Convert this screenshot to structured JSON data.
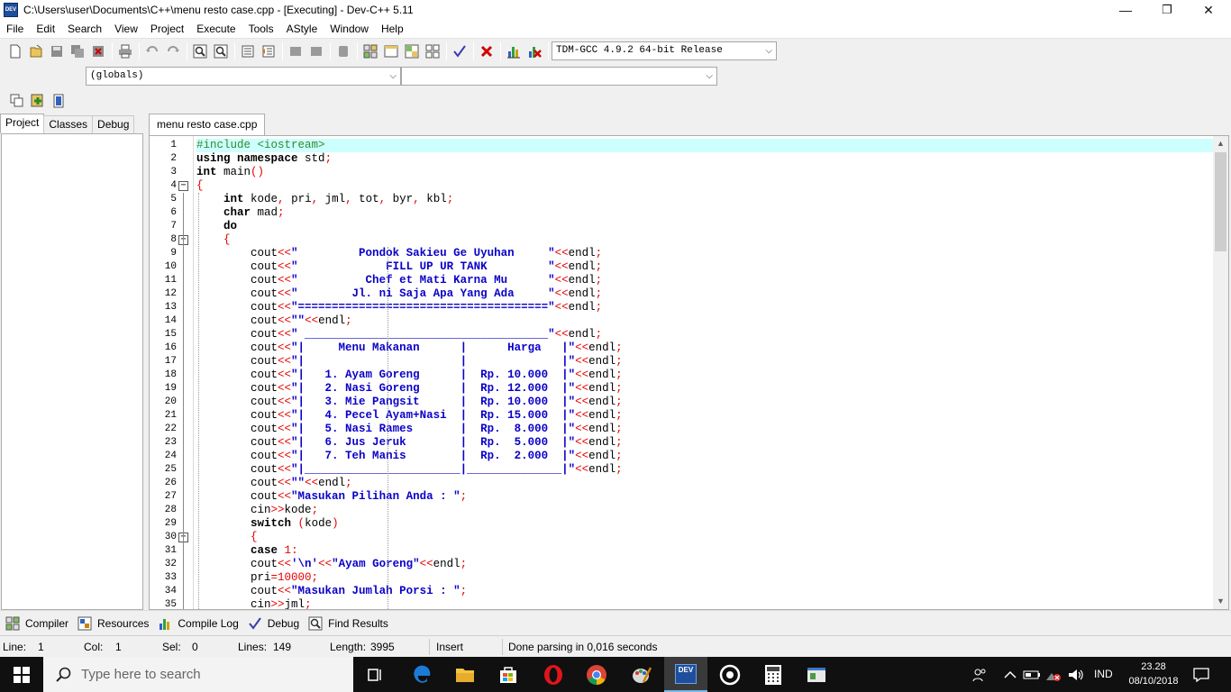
{
  "window": {
    "title": "C:\\Users\\user\\Documents\\C++\\menu resto case.cpp - [Executing] - Dev-C++ 5.11",
    "app_icon_label": "DEV",
    "minimize": "—",
    "maximize": "❐",
    "close": "✕"
  },
  "menu": [
    "File",
    "Edit",
    "Search",
    "View",
    "Project",
    "Execute",
    "Tools",
    "AStyle",
    "Window",
    "Help"
  ],
  "toolbar": {
    "compiler_select": "TDM-GCC 4.9.2 64-bit Release"
  },
  "scope": {
    "class_select": "(globals)",
    "member_select": ""
  },
  "left_panel": {
    "tabs": [
      "Project",
      "Classes",
      "Debug"
    ]
  },
  "editor": {
    "file_tab": "menu resto case.cpp"
  },
  "code_lines": [
    "#include <iostream>",
    "using namespace std;",
    "int main()",
    "{",
    "    int kode, pri, jml, tot, byr, kbl;",
    "    char mad;",
    "    do",
    "    {",
    "        cout<<\"         Pondok Sakieu Ge Uyuhan     \"<<endl;",
    "        cout<<\"             FILL UP UR TANK         \"<<endl;",
    "        cout<<\"          Chef et Mati Karna Mu      \"<<endl;",
    "        cout<<\"        Jl. ni Saja Apa Yang Ada     \"<<endl;",
    "        cout<<\"=====================================\"<<endl;",
    "        cout<<\"\"<<endl;",
    "        cout<<\" ____________________________________\"<<endl;",
    "        cout<<\"|     Menu Makanan      |      Harga   |\"<<endl;",
    "        cout<<\"|                       |              |\"<<endl;",
    "        cout<<\"|   1. Ayam Goreng      |  Rp. 10.000  |\"<<endl;",
    "        cout<<\"|   2. Nasi Goreng      |  Rp. 12.000  |\"<<endl;",
    "        cout<<\"|   3. Mie Pangsit      |  Rp. 10.000  |\"<<endl;",
    "        cout<<\"|   4. Pecel Ayam+Nasi  |  Rp. 15.000  |\"<<endl;",
    "        cout<<\"|   5. Nasi Rames       |  Rp.  8.000  |\"<<endl;",
    "        cout<<\"|   6. Jus Jeruk        |  Rp.  5.000  |\"<<endl;",
    "        cout<<\"|   7. Teh Manis        |  Rp.  2.000  |\"<<endl;",
    "        cout<<\"|_______________________|______________|\"<<endl;",
    "        cout<<\"\"<<endl;",
    "        cout<<\"Masukan Pilihan Anda : \";",
    "        cin>>kode;",
    "        switch (kode)",
    "        {",
    "        case 1:",
    "        cout<<'\\n'<<\"Ayam Goreng\"<<endl;",
    "        pri=10000;",
    "        cout<<\"Masukan Jumlah Porsi : \";",
    "        cin>>jml;"
  ],
  "bottom_tabs": [
    "Compiler",
    "Resources",
    "Compile Log",
    "Debug",
    "Find Results"
  ],
  "status": {
    "line_label": "Line:",
    "line_value": "1",
    "col_label": "Col:",
    "col_value": "1",
    "sel_label": "Sel:",
    "sel_value": "0",
    "lines_label": "Lines:",
    "lines_value": "149",
    "length_label": "Length:",
    "length_value": "3995",
    "mode": "Insert",
    "message": "Done parsing in 0,016 seconds"
  },
  "taskbar": {
    "search_placeholder": "Type here to search",
    "language": "IND",
    "time": "23.28",
    "date": "08/10/2018",
    "devcpp_label": "DEV"
  },
  "colors": {
    "current_line": "#ccfffd",
    "string": "#0a00c8",
    "preprocessor": "#2e8b2e",
    "operator": "#e60000",
    "taskbar": "#101010"
  }
}
